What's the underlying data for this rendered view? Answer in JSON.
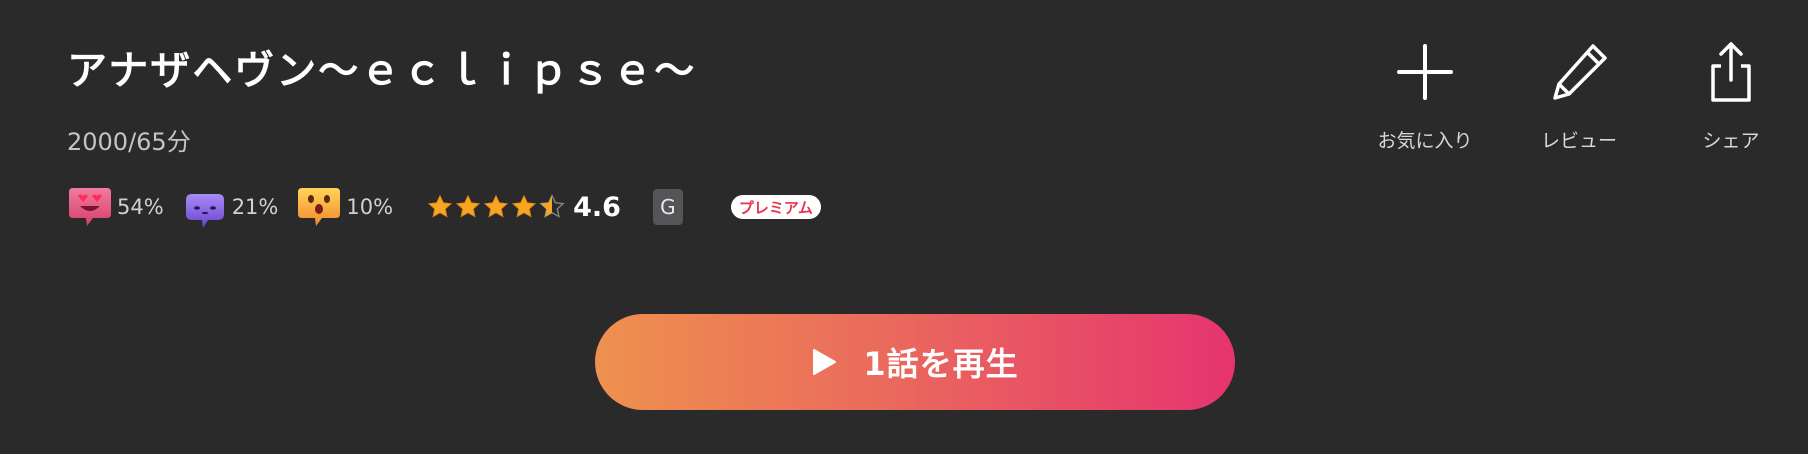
{
  "header": {
    "title": "アナザヘヴン〜ｅｃｌｉｐｓｅ〜",
    "meta": "2000/65分"
  },
  "reactions": [
    {
      "icon": "heart-eyes-emoji-icon",
      "percent": "54%",
      "color": "#e0537a"
    },
    {
      "icon": "sleepy-emoji-icon",
      "percent": "21%",
      "color": "#8c5ee0"
    },
    {
      "icon": "surprised-emoji-icon",
      "percent": "10%",
      "color": "#f0b43c"
    }
  ],
  "rating": {
    "stars": 4.5,
    "value": "4.6",
    "star_color": "#f5a623"
  },
  "badges": {
    "age_rating": "G",
    "premium": "プレミアム"
  },
  "actions": {
    "favorite_label": "お気に入り",
    "review_label": "レビュー",
    "share_label": "シェア"
  },
  "play": {
    "label": "1話を再生",
    "gradient_start": "#ee914f",
    "gradient_end": "#e6346f"
  }
}
